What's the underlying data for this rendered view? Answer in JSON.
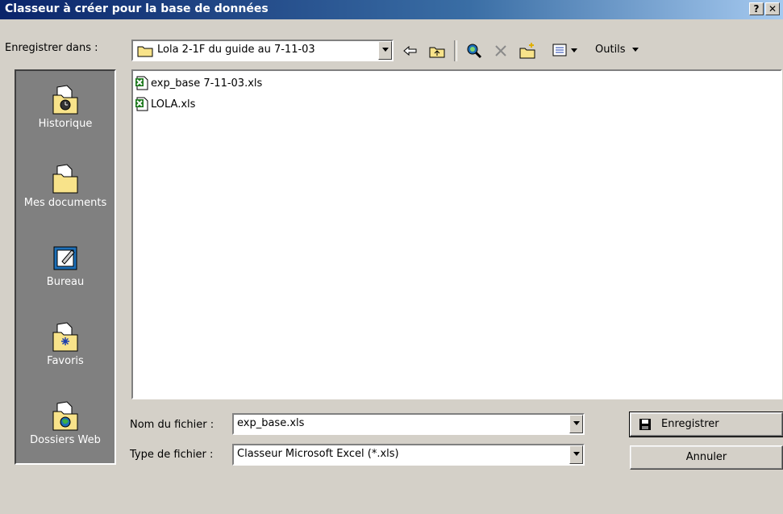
{
  "window": {
    "title": "Classeur à créer pour la base de données",
    "help_glyph": "?",
    "close_glyph": "✕"
  },
  "toolbar": {
    "save_in_label": "Enregistrer dans :",
    "current_folder": "Lola 2-1F du guide au 7-11-03",
    "tools_label": "Outils"
  },
  "places": [
    {
      "label": "Historique",
      "icon": "history-icon"
    },
    {
      "label": "Mes documents",
      "icon": "my-documents-icon"
    },
    {
      "label": "Bureau",
      "icon": "desktop-icon"
    },
    {
      "label": "Favoris",
      "icon": "favorites-icon"
    },
    {
      "label": "Dossiers Web",
      "icon": "web-folders-icon"
    }
  ],
  "files": [
    {
      "name": "exp_base 7-11-03.xls",
      "icon": "excel-file-icon"
    },
    {
      "name": "LOLA.xls",
      "icon": "excel-file-icon"
    }
  ],
  "form": {
    "filename_label": "Nom du fichier :",
    "filename_value": "exp_base.xls",
    "filetype_label": "Type de fichier :",
    "filetype_value": "Classeur Microsoft Excel (*.xls)"
  },
  "buttons": {
    "save_label": "Enregistrer",
    "cancel_label": "Annuler"
  },
  "colors": {
    "title_bar": "#0a246a",
    "dialog_bg": "#d4d0c8",
    "places_bar": "#808080"
  }
}
